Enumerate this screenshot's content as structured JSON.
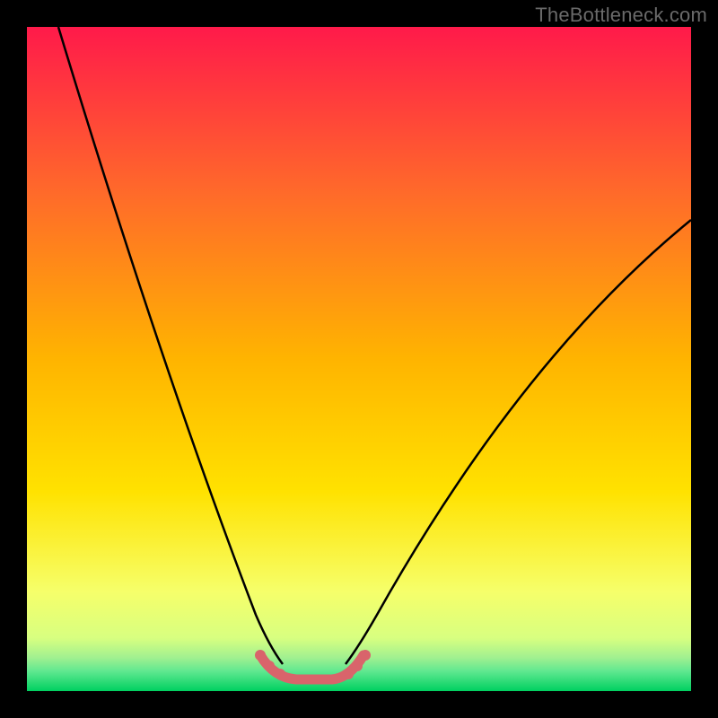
{
  "watermark": "TheBottleneck.com",
  "chart_data": {
    "type": "line",
    "title": "",
    "xlabel": "",
    "ylabel": "",
    "x": [
      0.0,
      0.02,
      0.04,
      0.06,
      0.08,
      0.1,
      0.12,
      0.14,
      0.16,
      0.18,
      0.2,
      0.22,
      0.24,
      0.26,
      0.28,
      0.3,
      0.32,
      0.34,
      0.36,
      0.38,
      0.4,
      0.42,
      0.44,
      0.46,
      0.48,
      0.5,
      0.55,
      0.6,
      0.65,
      0.7,
      0.75,
      0.8,
      0.85,
      0.9,
      0.95,
      1.0
    ],
    "values": [
      1.0,
      0.94,
      0.88,
      0.81,
      0.75,
      0.69,
      0.62,
      0.56,
      0.5,
      0.44,
      0.37,
      0.31,
      0.25,
      0.2,
      0.15,
      0.1,
      0.07,
      0.04,
      0.02,
      0.01,
      0.0,
      0.0,
      0.0,
      0.01,
      0.02,
      0.04,
      0.1,
      0.17,
      0.24,
      0.31,
      0.38,
      0.45,
      0.52,
      0.59,
      0.65,
      0.71
    ],
    "xlim": [
      0,
      1
    ],
    "ylim": [
      0,
      1
    ],
    "background_gradient": {
      "top": "#ff1a4a",
      "upper_mid": "#ff8a1e",
      "mid": "#ffe200",
      "lower": "#f6ff6a",
      "bottom": "#00e060"
    },
    "highlight_segment": {
      "x_start": 0.34,
      "x_end": 0.48,
      "color": "#d9646b"
    }
  }
}
